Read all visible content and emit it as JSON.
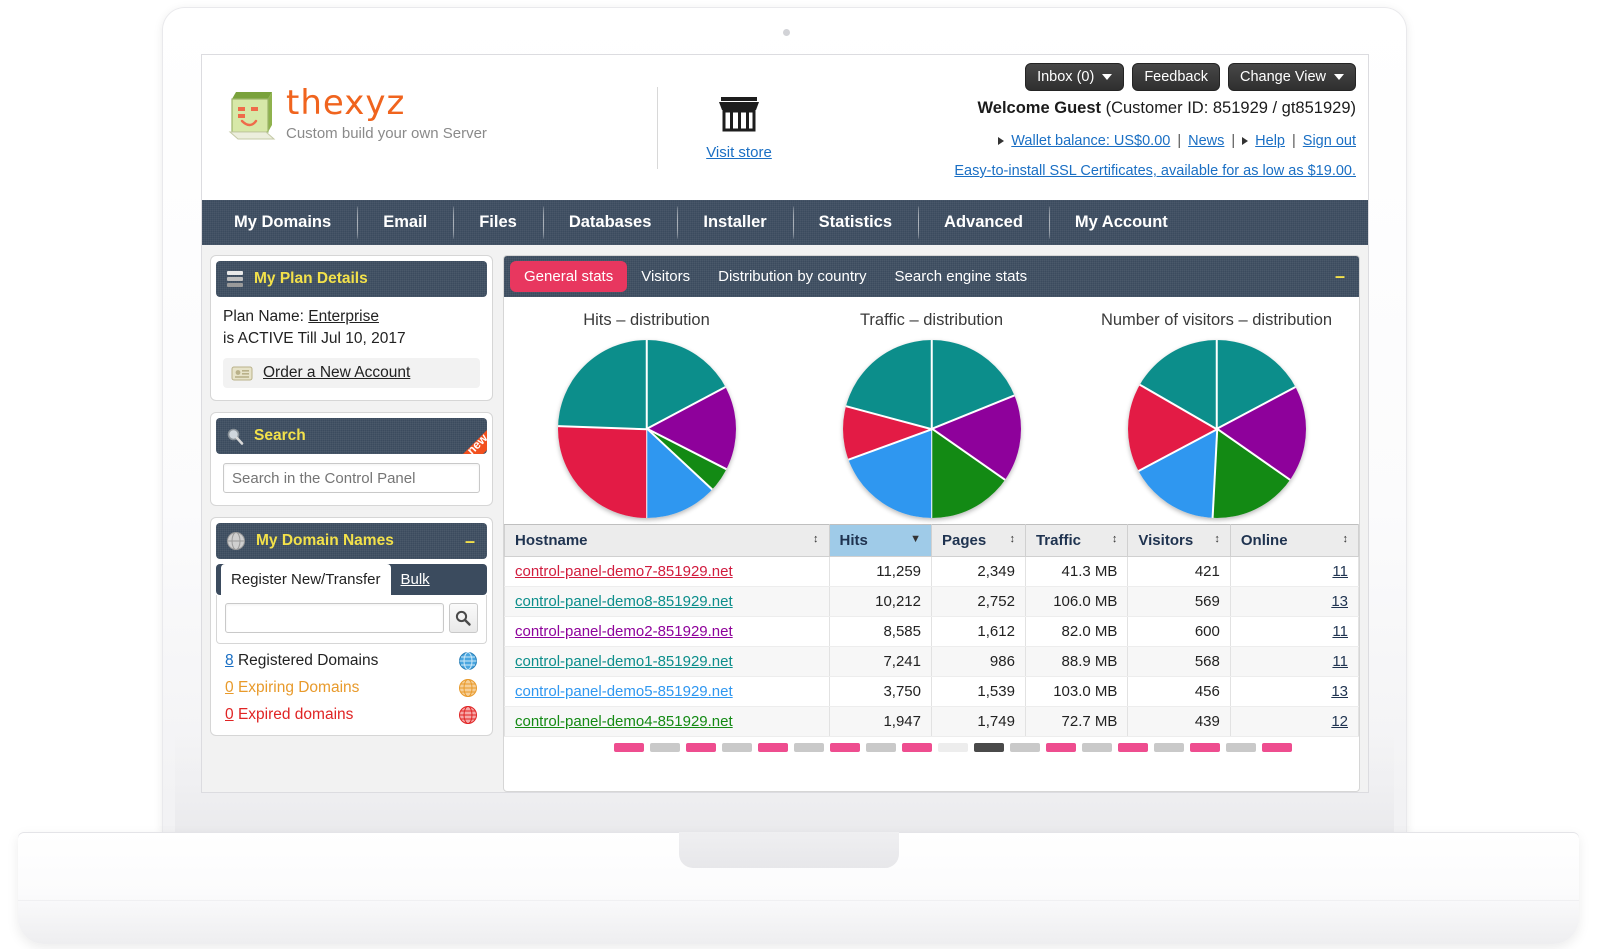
{
  "header": {
    "buttons": [
      {
        "label": "Inbox (0)",
        "caret": true
      },
      {
        "label": "Feedback",
        "caret": false
      },
      {
        "label": "Change View",
        "caret": true
      }
    ],
    "brand_name": "thexyz",
    "brand_tagline": "Custom build your own Server",
    "store_label": "Visit store",
    "welcome_bold": "Welcome Guest",
    "welcome_rest": "(Customer ID: 851929 / gt851929)",
    "links": [
      {
        "label": "Wallet balance: US$0.00",
        "arrow": true
      },
      {
        "label": "News",
        "arrow": false
      },
      {
        "label": "Help",
        "arrow": true
      },
      {
        "label": "Sign out",
        "arrow": false
      }
    ],
    "separator": "|",
    "ssl_promo": "Easy-to-install SSL Certificates, available for as low as $19.00."
  },
  "nav": {
    "items": [
      "My Domains",
      "Email",
      "Files",
      "Databases",
      "Installer",
      "Statistics",
      "Advanced",
      "My Account"
    ]
  },
  "sidebar": {
    "plan_panel": {
      "title": "My Plan Details",
      "plan_label": "Plan Name:",
      "plan_value": "Enterprise",
      "status_line": "is ACTIVE Till Jul 10, 2017",
      "order_link": "Order a New Account"
    },
    "search_panel": {
      "title": "Search",
      "ribbon": "new",
      "placeholder": "Search in the Control Panel",
      "value": ""
    },
    "domains_panel": {
      "title": "My Domain Names",
      "collapse": "–",
      "tabs": [
        {
          "label": "Register New/Transfer",
          "active": true
        },
        {
          "label": "Bulk",
          "active": false
        }
      ],
      "input_value": "",
      "input_placeholder": "",
      "stats": [
        {
          "count": "8",
          "label": "Registered Domains",
          "color": "#1f3350",
          "icon": "globe-blue-icon"
        },
        {
          "count": "0",
          "label": "Expiring Domains",
          "color": "#e89a2b",
          "icon": "globe-orange-icon"
        },
        {
          "count": "0",
          "label": "Expired domains",
          "color": "#e02424",
          "icon": "globe-red-icon"
        }
      ]
    }
  },
  "stats": {
    "tabs": [
      {
        "label": "General stats",
        "active": true
      },
      {
        "label": "Visitors",
        "active": false
      },
      {
        "label": "Distribution by country",
        "active": false
      },
      {
        "label": "Search engine stats",
        "active": false
      }
    ],
    "collapse": "–",
    "accent_tab_color": "#e8375f",
    "table": {
      "columns": [
        {
          "label": "Hostname",
          "sorted": false,
          "sort_icon": "↕"
        },
        {
          "label": "Hits",
          "sorted": true,
          "sort_icon": "▼"
        },
        {
          "label": "Pages",
          "sorted": false,
          "sort_icon": "↕"
        },
        {
          "label": "Traffic",
          "sorted": false,
          "sort_icon": "↕"
        },
        {
          "label": "Visitors",
          "sorted": false,
          "sort_icon": "↕"
        },
        {
          "label": "Online",
          "sorted": false,
          "sort_icon": "↕"
        }
      ],
      "rows": [
        {
          "hostname": "control-panel-demo7-851929.net",
          "color": "#d11b3e",
          "hits": "11,259",
          "pages": "2,349",
          "traffic": "41.3 MB",
          "visitors": "421",
          "online": "11"
        },
        {
          "hostname": "control-panel-demo8-851929.net",
          "color": "#0c8e8b",
          "hits": "10,212",
          "pages": "2,752",
          "traffic": "106.0 MB",
          "visitors": "569",
          "online": "13"
        },
        {
          "hostname": "control-panel-demo2-851929.net",
          "color": "#8e019b",
          "hits": "8,585",
          "pages": "1,612",
          "traffic": "82.0 MB",
          "visitors": "600",
          "online": "11"
        },
        {
          "hostname": "control-panel-demo1-851929.net",
          "color": "#0c8e8b",
          "hits": "7,241",
          "pages": "986",
          "traffic": "88.9 MB",
          "visitors": "568",
          "online": "11"
        },
        {
          "hostname": "control-panel-demo5-851929.net",
          "color": "#2f97f0",
          "hits": "3,750",
          "pages": "1,539",
          "traffic": "103.0 MB",
          "visitors": "456",
          "online": "13"
        },
        {
          "hostname": "control-panel-demo4-851929.net",
          "color": "#138a14",
          "hits": "1,947",
          "pages": "1,749",
          "traffic": "72.7 MB",
          "visitors": "439",
          "online": "12"
        }
      ]
    }
  },
  "chart_data": [
    {
      "type": "pie",
      "title": "Hits – distribution",
      "labels": [
        "control-panel-demo7-851929.net",
        "control-panel-demo8-851929.net",
        "control-panel-demo2-851929.net",
        "control-panel-demo1-851929.net",
        "control-panel-demo5-851929.net",
        "control-panel-demo4-851929.net"
      ],
      "values": [
        11259,
        10212,
        8585,
        7241,
        3750,
        1947
      ],
      "colors": [
        "#d11b3e",
        "#0c8e8b",
        "#8e019b",
        "#0c8e8b",
        "#2f97f0",
        "#138a14"
      ],
      "slices_deg": [
        {
          "color": "#0c8e8b",
          "start": 0,
          "end": 62
        },
        {
          "color": "#8e019b",
          "start": 62,
          "end": 117
        },
        {
          "color": "#138a14",
          "start": 117,
          "end": 133
        },
        {
          "color": "#2f97f0",
          "start": 133,
          "end": 180
        },
        {
          "color": "#e31b45",
          "start": 180,
          "end": 272
        },
        {
          "color": "#0c8e8b",
          "start": 272,
          "end": 360
        }
      ],
      "legend": "none"
    },
    {
      "type": "pie",
      "title": "Traffic – distribution",
      "labels": [
        "control-panel-demo8-851929.net",
        "control-panel-demo5-851929.net",
        "control-panel-demo1-851929.net",
        "control-panel-demo2-851929.net",
        "control-panel-demo4-851929.net",
        "control-panel-demo7-851929.net"
      ],
      "values": [
        106.0,
        103.0,
        88.9,
        82.0,
        72.7,
        41.3
      ],
      "colors": [
        "#0c8e8b",
        "#2f97f0",
        "#0c8e8b",
        "#8e019b",
        "#138a14",
        "#e31b45"
      ],
      "slices_deg": [
        {
          "color": "#0c8e8b",
          "start": 0,
          "end": 68
        },
        {
          "color": "#8e019b",
          "start": 68,
          "end": 125
        },
        {
          "color": "#138a14",
          "start": 125,
          "end": 180
        },
        {
          "color": "#2f97f0",
          "start": 180,
          "end": 250
        },
        {
          "color": "#e31b45",
          "start": 250,
          "end": 285
        },
        {
          "color": "#0c8e8b",
          "start": 285,
          "end": 360
        }
      ],
      "legend": "none"
    },
    {
      "type": "pie",
      "title": "Number of visitors – distribution",
      "labels": [
        "control-panel-demo2-851929.net",
        "control-panel-demo8-851929.net",
        "control-panel-demo1-851929.net",
        "control-panel-demo5-851929.net",
        "control-panel-demo4-851929.net",
        "control-panel-demo7-851929.net"
      ],
      "values": [
        600,
        569,
        568,
        456,
        439,
        421
      ],
      "colors": [
        "#8e019b",
        "#0c8e8b",
        "#0c8e8b",
        "#2f97f0",
        "#138a14",
        "#e31b45"
      ],
      "slices_deg": [
        {
          "color": "#0c8e8b",
          "start": 0,
          "end": 62
        },
        {
          "color": "#8e019b",
          "start": 62,
          "end": 125
        },
        {
          "color": "#138a14",
          "start": 125,
          "end": 183
        },
        {
          "color": "#2f97f0",
          "start": 183,
          "end": 242
        },
        {
          "color": "#e31b45",
          "start": 242,
          "end": 300
        },
        {
          "color": "#0c8e8b",
          "start": 300,
          "end": 360
        }
      ],
      "legend": "none"
    }
  ],
  "footer_strip": {
    "chips": [
      "pink",
      "gray",
      "pink",
      "gray",
      "pink",
      "gray",
      "pink",
      "gray",
      "pink",
      "light",
      "dark",
      "gray",
      "pink",
      "gray",
      "pink",
      "gray",
      "pink",
      "gray",
      "pink"
    ]
  }
}
